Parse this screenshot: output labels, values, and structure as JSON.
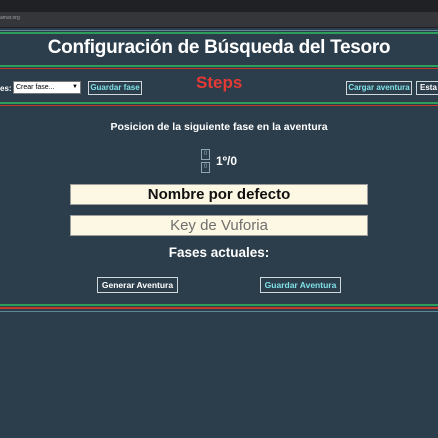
{
  "browser": {
    "url_fragment": "amar.org"
  },
  "header": {
    "title": "Configuración de Búsqueda del Tesoro"
  },
  "toolbar": {
    "fases_label": "es:",
    "select_value": "Crear fase...",
    "guardar_fase": "Guardar fase",
    "steps": "Steps",
    "cargar_aventura": "Cargar aventura",
    "esta_partial": "Esta"
  },
  "position": {
    "label": "Posicion de la siguiente fase en la aventura",
    "value": "1º/0"
  },
  "fields": {
    "nombre": "Nombre por defecto",
    "vuforia_placeholder": "Key de Vuforia"
  },
  "fases": {
    "heading": "Fases actuales:"
  },
  "actions": {
    "generar": "Generar Aventura",
    "guardar": "Guardar Aventura"
  },
  "colors": {
    "background": "#2c3e4c",
    "accent_green": "#2e9e5b",
    "accent_red": "#c0392b",
    "steps_red": "#e53935",
    "button_text": "#7fe0e6",
    "field_bg": "#fdf8e4"
  }
}
